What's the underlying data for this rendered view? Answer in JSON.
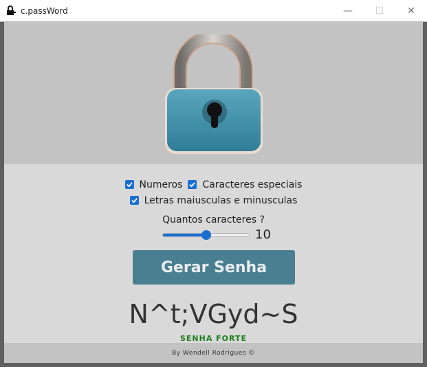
{
  "window": {
    "title": "c.passWord",
    "controls": {
      "minimize": "—",
      "maximize": "☐",
      "close": "✕"
    }
  },
  "options": {
    "numeros": {
      "label": "Numeros",
      "checked": true
    },
    "especiais": {
      "label": "Caracteres especiais",
      "checked": true
    },
    "maiusculas": {
      "label": "Letras maiusculas e minusculas",
      "checked": true
    }
  },
  "length": {
    "label": "Quantos caracteres ?",
    "value": "10",
    "slider_fraction": 0.5
  },
  "button": {
    "label": "Gerar Senha"
  },
  "result": {
    "password": "N^t;VGyd~S",
    "strength": "SENHA FORTE"
  },
  "footer": {
    "credit": "By Wendell Rodrigues ©"
  },
  "colors": {
    "accent": "#1a6fd0",
    "button": "#4a7f92",
    "strength": "#1a7d1a",
    "hero_bg": "#c4c3c4",
    "content_bg": "#d9d9d9"
  }
}
